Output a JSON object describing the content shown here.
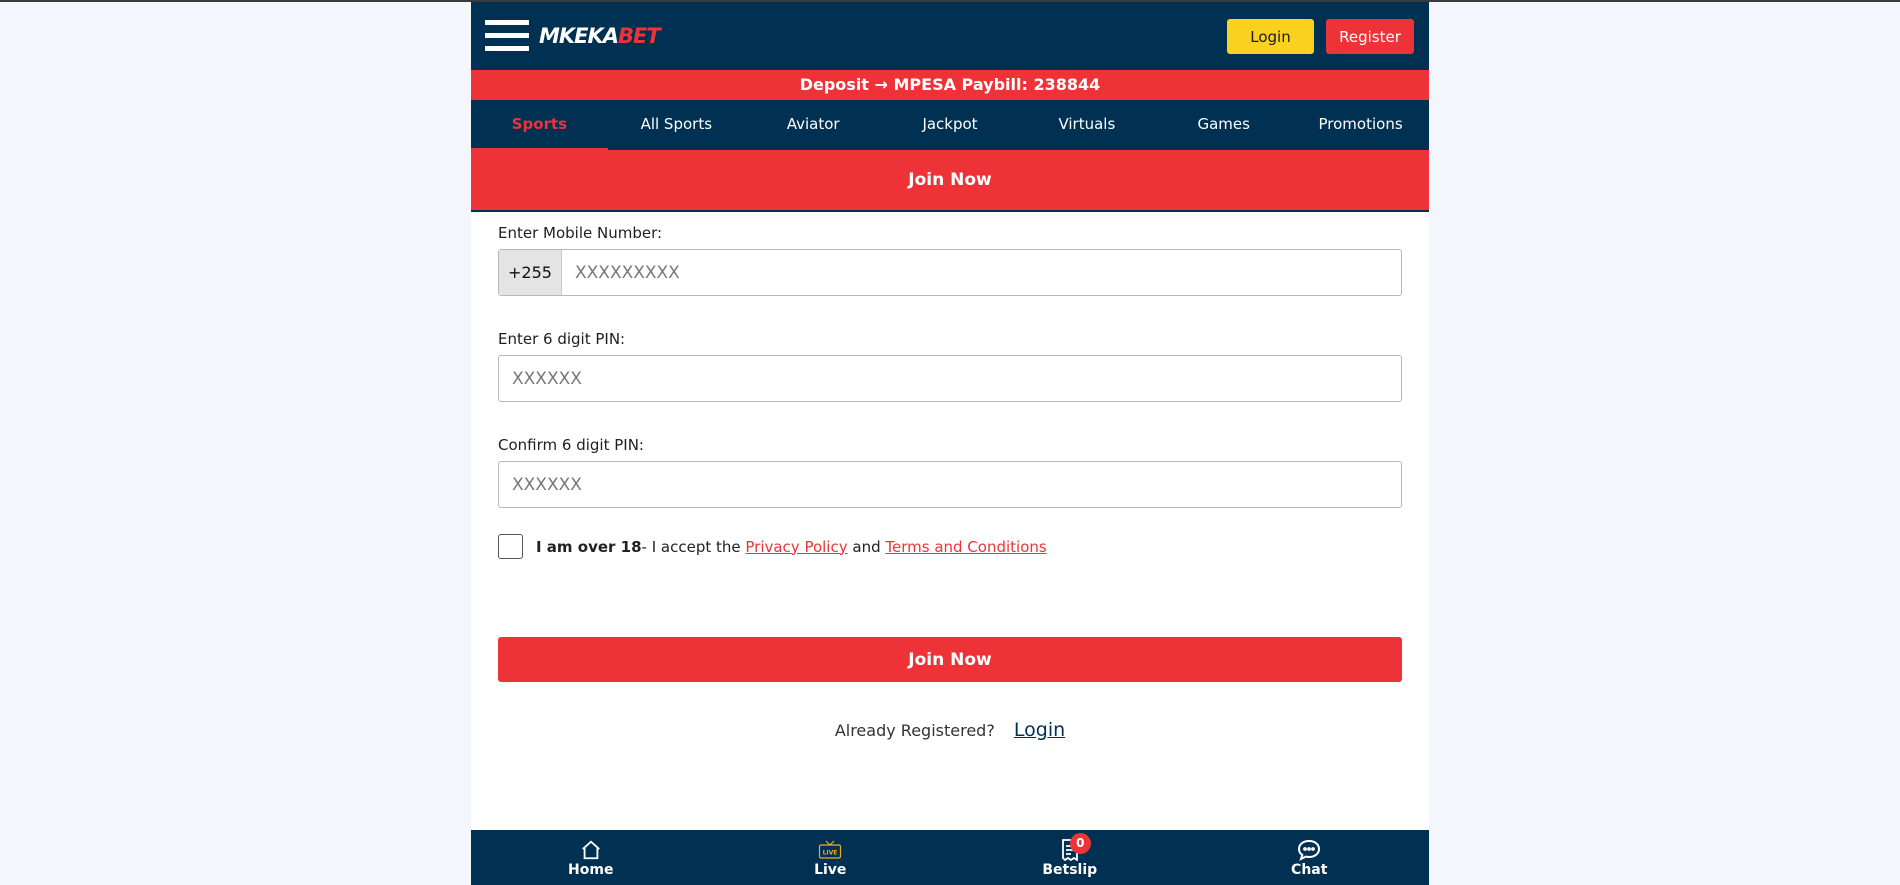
{
  "header": {
    "logo_part1": "MKEKA",
    "logo_part2": "BET",
    "login_label": "Login",
    "register_label": "Register"
  },
  "deposit_bar": {
    "text": "Deposit → MPESA Paybill: 238844"
  },
  "nav": {
    "items": [
      {
        "label": "Sports"
      },
      {
        "label": "All Sports"
      },
      {
        "label": "Aviator"
      },
      {
        "label": "Jackpot"
      },
      {
        "label": "Virtuals"
      },
      {
        "label": "Games"
      },
      {
        "label": "Promotions"
      }
    ],
    "active": "Sports"
  },
  "join_banner": {
    "title": "Join Now"
  },
  "form": {
    "mobile_label": "Enter Mobile Number:",
    "mobile_prefix": "+255",
    "mobile_placeholder": "XXXXXXXXX",
    "pin_label": "Enter 6 digit PIN:",
    "pin_placeholder": "XXXXXX",
    "confirm_label": "Confirm 6 digit PIN:",
    "confirm_placeholder": "XXXXXX",
    "age_bold": "I am over 18",
    "age_text": "- I accept the ",
    "privacy_link": "Privacy Policy",
    "and_text": " and ",
    "terms_link": "Terms and Conditions",
    "submit_label": "Join Now",
    "already_text": "Already Registered?",
    "login_link": "Login"
  },
  "footer": {
    "items": [
      {
        "label": "Home",
        "icon": "home-icon"
      },
      {
        "label": "Live",
        "icon": "live-icon"
      },
      {
        "label": "Betslip",
        "icon": "betslip-icon",
        "badge": "0"
      },
      {
        "label": "Chat",
        "icon": "chat-icon"
      }
    ]
  },
  "colors": {
    "navy": "#003153",
    "red": "#ee3338",
    "yellow": "#fbd11f"
  }
}
